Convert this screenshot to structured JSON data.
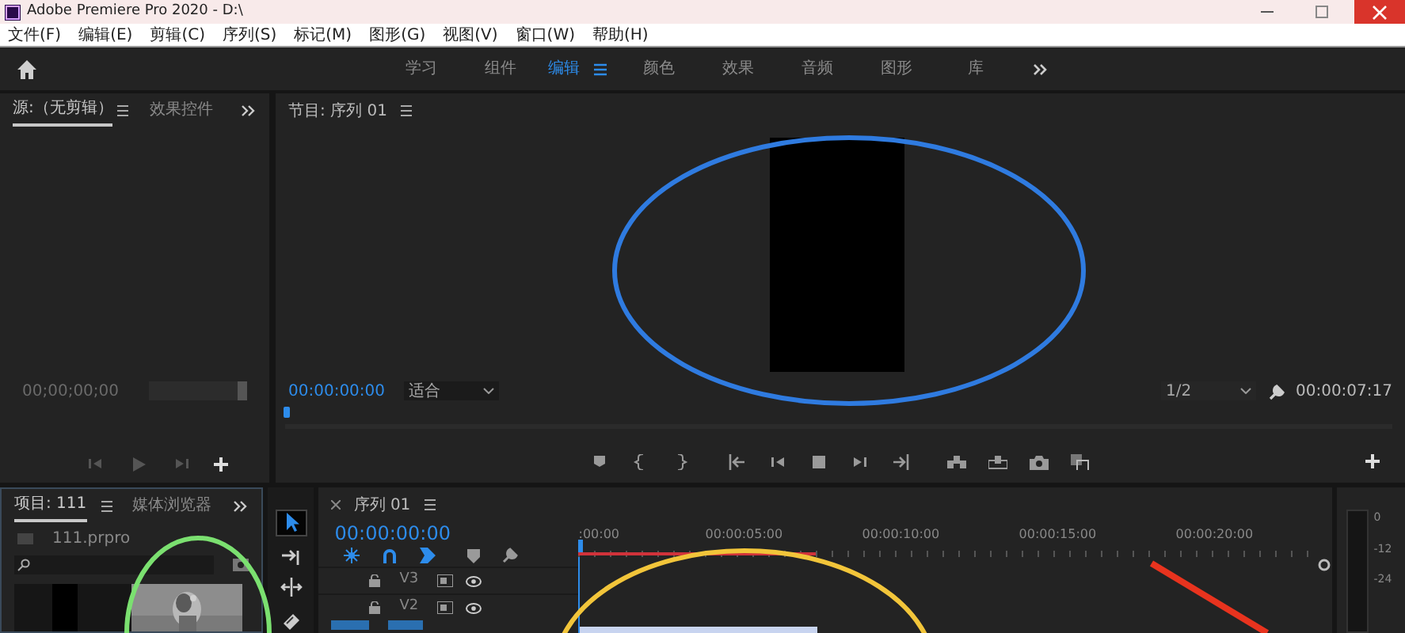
{
  "window": {
    "title": "Adobe Premiere Pro 2020 - D:\\"
  },
  "menu": [
    "文件(F)",
    "编辑(E)",
    "剪辑(C)",
    "序列(S)",
    "标记(M)",
    "图形(G)",
    "视图(V)",
    "窗口(W)",
    "帮助(H)"
  ],
  "workspaces": [
    {
      "label": "学习",
      "selected": false
    },
    {
      "label": "组件",
      "selected": false
    },
    {
      "label": "编辑",
      "selected": true
    },
    {
      "label": "颜色",
      "selected": false
    },
    {
      "label": "效果",
      "selected": false
    },
    {
      "label": "音频",
      "selected": false
    },
    {
      "label": "图形",
      "selected": false
    },
    {
      "label": "库",
      "selected": false
    }
  ],
  "source_panel": {
    "tabs": [
      {
        "label": "源:（无剪辑）",
        "selected": true
      },
      {
        "label": "效果控件",
        "selected": false
      }
    ],
    "timecode": "00;00;00;00"
  },
  "program_panel": {
    "title": "节目: 序列 01",
    "timecode": "00:00:00:00",
    "zoom": "适合",
    "resolution": "1/2",
    "duration": "00:00:07:17"
  },
  "project_panel": {
    "tabs": [
      {
        "label": "项目: 111",
        "selected": true
      },
      {
        "label": "媒体浏览器",
        "selected": false
      }
    ],
    "file": "111.prpro"
  },
  "tools": [
    {
      "selected": true
    },
    {
      "selected": false
    },
    {
      "selected": false
    },
    {
      "selected": false
    }
  ],
  "timeline": {
    "title": "序列 01",
    "timecode": "00:00:00:00",
    "ruler": [
      ":00:00",
      "00:00:05:00",
      "00:00:10:00",
      "00:00:15:00",
      "00:00:20:00"
    ],
    "tracks": [
      {
        "name": "V3"
      },
      {
        "name": "V2"
      }
    ]
  },
  "meter": {
    "labels": [
      "0",
      "-12",
      "-24"
    ]
  },
  "annotations": [
    {
      "kind": "ellipse",
      "color": "#2f7be0"
    },
    {
      "kind": "ellipse",
      "color": "#7be070"
    },
    {
      "kind": "ellipse",
      "color": "#f2c53a"
    },
    {
      "kind": "arrow",
      "color": "#e8331e"
    }
  ]
}
